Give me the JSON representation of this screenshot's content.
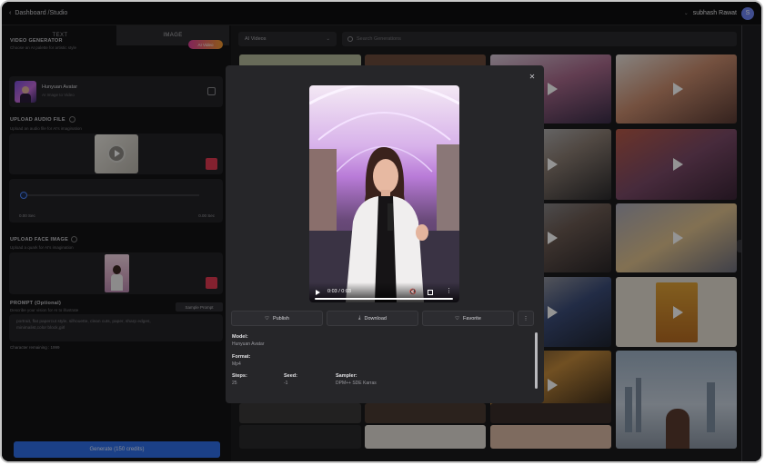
{
  "header": {
    "breadcrumb": "Dashboard /Studio",
    "user_name": "subhash Rawat",
    "avatar_initial": "S"
  },
  "tabs": [
    {
      "label": "TEXT"
    },
    {
      "label": "IMAGE"
    }
  ],
  "video_generator": {
    "title": "VIDEO GENERATOR",
    "subtitle": "Choose an AI palette for artistic style",
    "badge": "AI Video",
    "model_name": "Hunyuan Avatar",
    "model_sub": "AI Image to Video"
  },
  "audio": {
    "title": "UPLOAD AUDIO FILE",
    "subtitle": "Upload an audio file for AI's imagination",
    "start_label": "0.00 Sec",
    "end_label": "0.00 Sec"
  },
  "face": {
    "title": "UPLOAD FACE IMAGE",
    "subtitle": "Upload a quark for AI's imagination"
  },
  "prompt": {
    "title": "PROMPT (Optional)",
    "subtitle": "Describe your vision for AI to illustrate",
    "sample_btn": "Sample Prompt",
    "text": "portrait, flat papercut style, silhouette, clean cuts, paper, sharp edges, minimalist,color block,girl",
    "remaining": "Character remaining : 1999"
  },
  "generate_button": "Generate (150 credits)",
  "gallery": {
    "filter": "AI Videos",
    "search_placeholder": "Search Generations"
  },
  "modal": {
    "time": "0:03 / 0:03",
    "actions": {
      "publish": "Publish",
      "download": "Download",
      "favorite": "Favorite"
    },
    "model_label": "Model:",
    "model_value": "Hunyuan Avatar",
    "format_label": "Format:",
    "format_value": "Mp4",
    "steps_label": "Steps:",
    "steps_value": "25",
    "seed_label": "Seed:",
    "seed_value": "-1",
    "sampler_label": "Sampler:",
    "sampler_value": "DPM++ SDE Karras"
  }
}
